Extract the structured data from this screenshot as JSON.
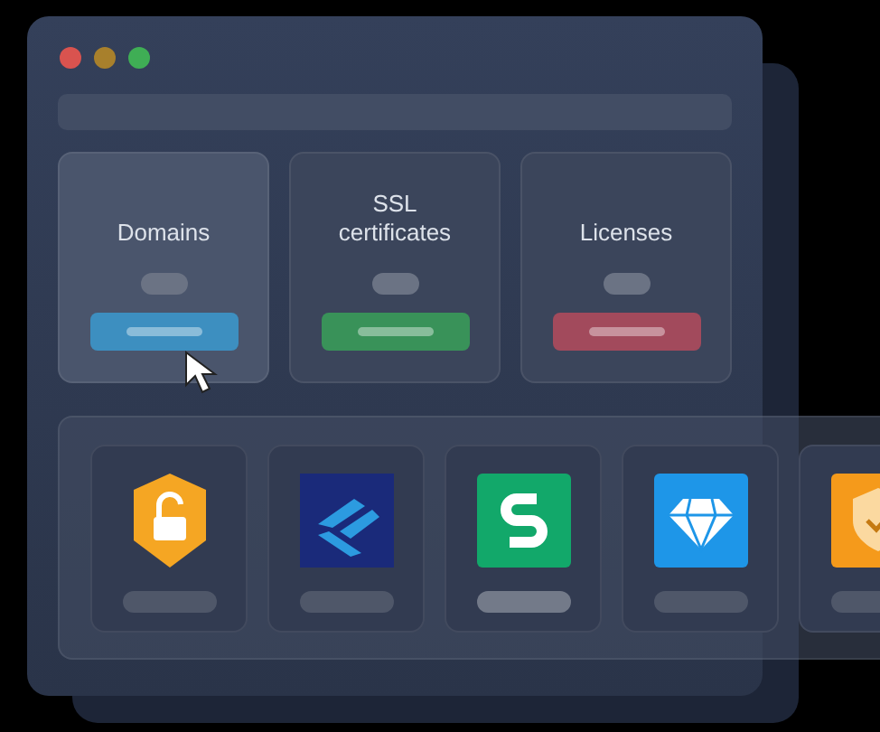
{
  "window": {
    "controls": [
      {
        "kind": "close"
      },
      {
        "kind": "minimize"
      },
      {
        "kind": "maximize"
      }
    ]
  },
  "cards": [
    {
      "title": "Domains",
      "selected": true,
      "color": "#3d8fc0"
    },
    {
      "title": "SSL certificates",
      "selected": false,
      "color": "#399259"
    },
    {
      "title": "Licenses",
      "selected": false,
      "color": "#a24a5c"
    }
  ],
  "tiles": [
    {
      "kind": "lock-shield",
      "selected": false
    },
    {
      "kind": "layers",
      "selected": false
    },
    {
      "kind": "s-logo",
      "selected": true
    },
    {
      "kind": "diamond",
      "selected": false
    },
    {
      "kind": "check-shield",
      "selected": false
    }
  ]
}
